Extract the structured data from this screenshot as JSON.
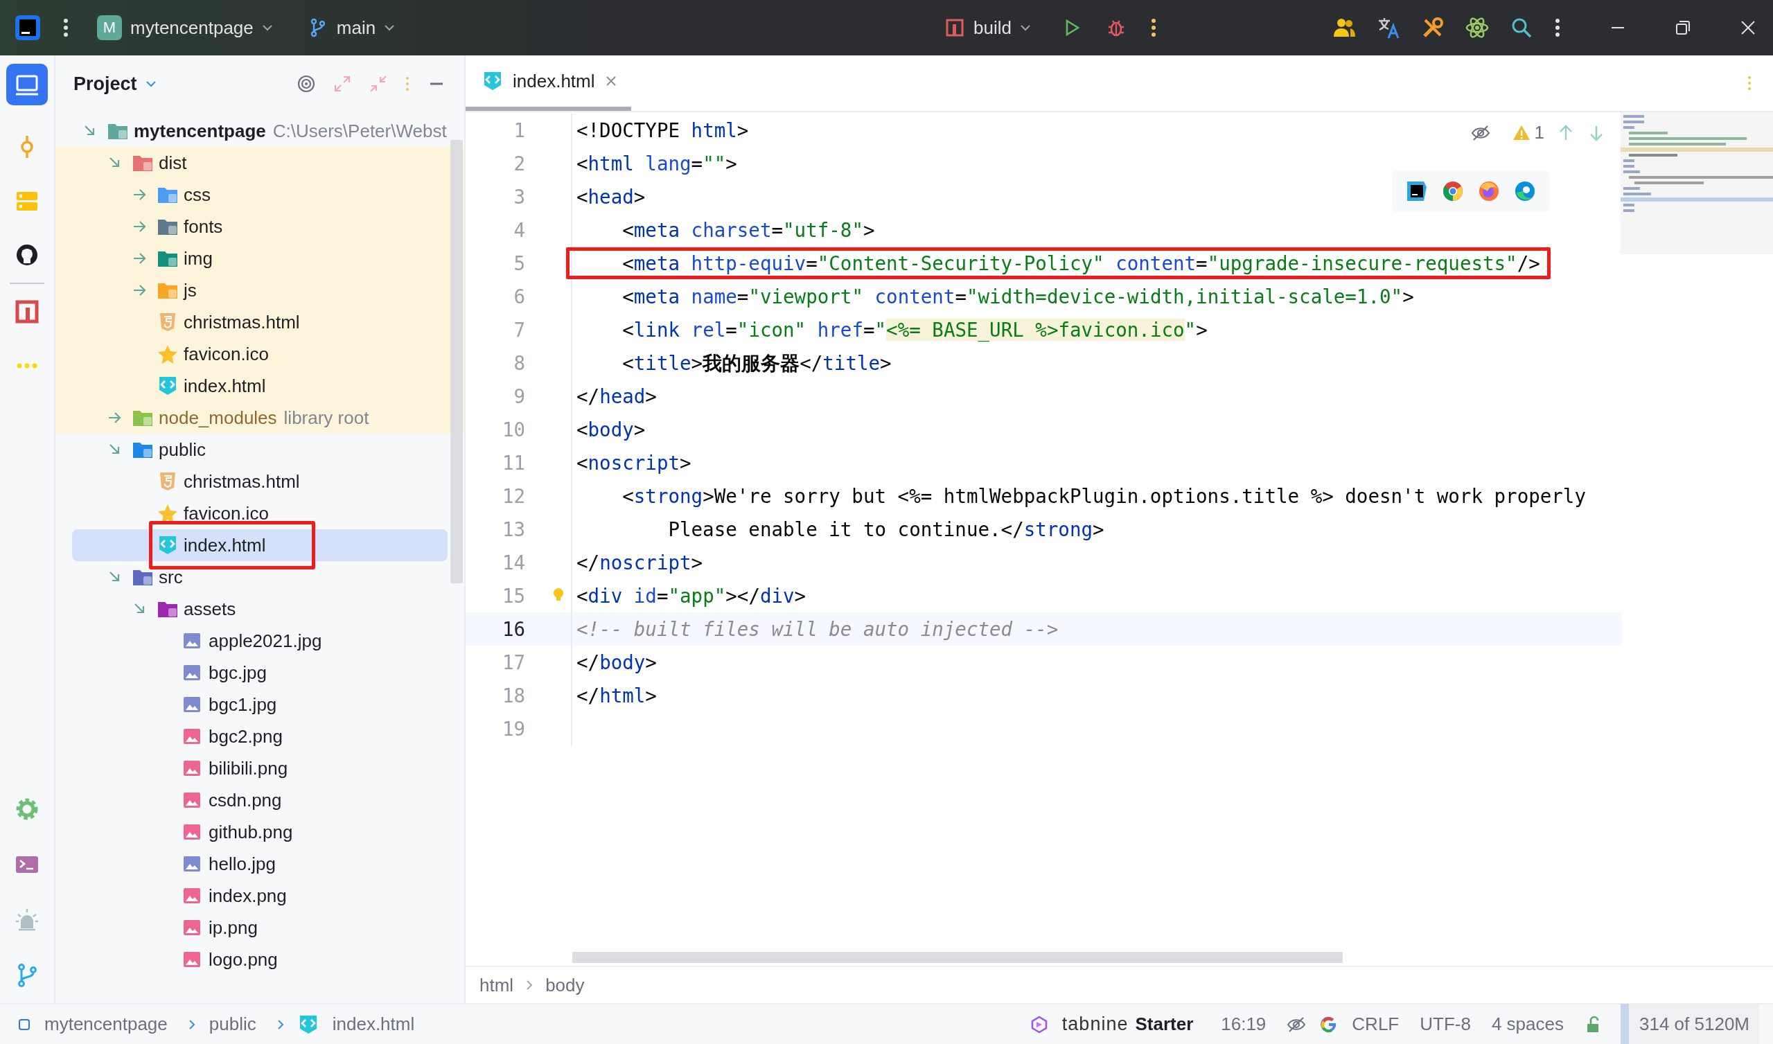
{
  "title_bar": {
    "project_badge": "M",
    "project": "mytencentpage",
    "branch": "main",
    "run_config": "build"
  },
  "project_panel": {
    "title": "Project"
  },
  "tree": [
    {
      "name": "mytencentpage",
      "kind": "module",
      "path": "C:\\Users\\Peter\\Webst",
      "expanded": true,
      "selected": false,
      "annotated": false,
      "children": [
        {
          "name": "dist",
          "kind": "dist",
          "expanded": true,
          "excluded": true,
          "selected": false,
          "annotated": false,
          "children": [
            {
              "name": "css",
              "kind": "css",
              "expanded": false,
              "selected": false,
              "annotated": false
            },
            {
              "name": "fonts",
              "kind": "fonts",
              "expanded": false,
              "selected": false,
              "annotated": false
            },
            {
              "name": "img",
              "kind": "img",
              "expanded": false,
              "selected": false,
              "annotated": false
            },
            {
              "name": "js",
              "kind": "js",
              "expanded": false,
              "selected": false,
              "annotated": false
            },
            {
              "name": "christmas.html",
              "kind": "html5",
              "selected": false,
              "annotated": false
            },
            {
              "name": "favicon.ico",
              "kind": "favicon",
              "selected": false,
              "annotated": false
            },
            {
              "name": "index.html",
              "kind": "webpage",
              "selected": false,
              "annotated": false
            }
          ]
        },
        {
          "name": "node_modules",
          "kind": "node",
          "suffix": "library root",
          "expanded": false,
          "excluded": true,
          "selected": false,
          "annotated": false
        },
        {
          "name": "public",
          "kind": "public",
          "expanded": true,
          "excluded": false,
          "selected": false,
          "annotated": false,
          "children": [
            {
              "name": "christmas.html",
              "kind": "html5",
              "selected": false,
              "annotated": false
            },
            {
              "name": "favicon.ico",
              "kind": "favicon",
              "selected": false,
              "annotated": false
            },
            {
              "name": "index.html",
              "kind": "webpage",
              "selected": true,
              "annotated": true
            }
          ]
        },
        {
          "name": "src",
          "kind": "src",
          "expanded": true,
          "excluded": false,
          "selected": false,
          "annotated": false,
          "children": [
            {
              "name": "assets",
              "kind": "assets",
              "expanded": true,
              "selected": false,
              "annotated": false,
              "children": [
                {
                  "name": "apple2021.jpg",
                  "kind": "jpg",
                  "selected": false,
                  "annotated": false
                },
                {
                  "name": "bgc.jpg",
                  "kind": "jpg",
                  "selected": false,
                  "annotated": false
                },
                {
                  "name": "bgc1.jpg",
                  "kind": "jpg",
                  "selected": false,
                  "annotated": false
                },
                {
                  "name": "bgc2.png",
                  "kind": "png",
                  "selected": false,
                  "annotated": false
                },
                {
                  "name": "bilibili.png",
                  "kind": "png",
                  "selected": false,
                  "annotated": false
                },
                {
                  "name": "csdn.png",
                  "kind": "png",
                  "selected": false,
                  "annotated": false
                },
                {
                  "name": "github.png",
                  "kind": "png",
                  "selected": false,
                  "annotated": false
                },
                {
                  "name": "hello.jpg",
                  "kind": "jpg",
                  "selected": false,
                  "annotated": false
                },
                {
                  "name": "index.png",
                  "kind": "png",
                  "selected": false,
                  "annotated": false
                },
                {
                  "name": "ip.png",
                  "kind": "png",
                  "selected": false,
                  "annotated": false
                },
                {
                  "name": "logo.png",
                  "kind": "png",
                  "selected": false,
                  "annotated": false
                }
              ]
            }
          ]
        }
      ]
    }
  ],
  "tabs": [
    {
      "label": "index.html",
      "selected": true
    }
  ],
  "inspection": {
    "warnings": "1"
  },
  "code": [
    {
      "no": "1",
      "current": false,
      "tokens": [
        {
          "kind": "p",
          "text": "<!DOCTYPE "
        },
        {
          "kind": "tag",
          "text": "html"
        },
        {
          "kind": "p",
          "text": ">"
        }
      ]
    },
    {
      "no": "2",
      "current": false,
      "tokens": [
        {
          "kind": "p",
          "text": "<"
        },
        {
          "kind": "tag",
          "text": "html"
        },
        {
          "kind": "attr",
          "text": " lang"
        },
        {
          "kind": "p",
          "text": "="
        },
        {
          "kind": "str",
          "text": "\"\""
        },
        {
          "kind": "p",
          "text": ">"
        }
      ]
    },
    {
      "no": "3",
      "current": false,
      "tokens": [
        {
          "kind": "p",
          "text": "<"
        },
        {
          "kind": "tag",
          "text": "head"
        },
        {
          "kind": "p",
          "text": ">"
        }
      ]
    },
    {
      "no": "4",
      "current": false,
      "tokens": [
        {
          "kind": "p",
          "text": "    <"
        },
        {
          "kind": "tag",
          "text": "meta"
        },
        {
          "kind": "attr",
          "text": " charset"
        },
        {
          "kind": "p",
          "text": "="
        },
        {
          "kind": "str",
          "text": "\"utf-8\""
        },
        {
          "kind": "p",
          "text": ">"
        }
      ]
    },
    {
      "no": "5",
      "current": false,
      "annotated": true,
      "tokens": [
        {
          "kind": "p",
          "text": "    <"
        },
        {
          "kind": "tag",
          "text": "meta"
        },
        {
          "kind": "attr",
          "text": " http-equiv"
        },
        {
          "kind": "p",
          "text": "="
        },
        {
          "kind": "str",
          "text": "\"Content-Security-Policy\""
        },
        {
          "kind": "attr",
          "text": " content"
        },
        {
          "kind": "p",
          "text": "="
        },
        {
          "kind": "str",
          "text": "\"upgrade-insecure-requests\""
        },
        {
          "kind": "p",
          "text": "/>"
        }
      ]
    },
    {
      "no": "6",
      "current": false,
      "tokens": [
        {
          "kind": "p",
          "text": "    <"
        },
        {
          "kind": "tag",
          "text": "meta"
        },
        {
          "kind": "attr",
          "text": " name"
        },
        {
          "kind": "p",
          "text": "="
        },
        {
          "kind": "str",
          "text": "\"viewport\""
        },
        {
          "kind": "attr",
          "text": " content"
        },
        {
          "kind": "p",
          "text": "="
        },
        {
          "kind": "str",
          "text": "\"width=device-width,initial-scale=1.0\""
        },
        {
          "kind": "p",
          "text": ">"
        }
      ]
    },
    {
      "no": "7",
      "current": false,
      "tokens": [
        {
          "kind": "p",
          "text": "    <"
        },
        {
          "kind": "tag",
          "text": "link"
        },
        {
          "kind": "attr",
          "text": " rel"
        },
        {
          "kind": "p",
          "text": "="
        },
        {
          "kind": "str",
          "text": "\"icon\""
        },
        {
          "kind": "attr",
          "text": " href"
        },
        {
          "kind": "p",
          "text": "="
        },
        {
          "kind": "str",
          "text": "\""
        },
        {
          "kind": "tpl",
          "text": "<%= BASE_URL %>favicon.ico"
        },
        {
          "kind": "str",
          "text": "\""
        },
        {
          "kind": "p",
          "text": ">"
        }
      ]
    },
    {
      "no": "8",
      "current": false,
      "tokens": [
        {
          "kind": "p",
          "text": "    <"
        },
        {
          "kind": "tag",
          "text": "title"
        },
        {
          "kind": "p",
          "text": ">"
        },
        {
          "kind": "bold",
          "text": "我的服务器"
        },
        {
          "kind": "p",
          "text": "</"
        },
        {
          "kind": "tag",
          "text": "title"
        },
        {
          "kind": "p",
          "text": ">"
        }
      ]
    },
    {
      "no": "9",
      "current": false,
      "tokens": [
        {
          "kind": "p",
          "text": "</"
        },
        {
          "kind": "tag",
          "text": "head"
        },
        {
          "kind": "p",
          "text": ">"
        }
      ]
    },
    {
      "no": "10",
      "current": false,
      "tokens": [
        {
          "kind": "p",
          "text": "<"
        },
        {
          "kind": "tag",
          "text": "body"
        },
        {
          "kind": "p",
          "text": ">"
        }
      ]
    },
    {
      "no": "11",
      "current": false,
      "tokens": [
        {
          "kind": "p",
          "text": "<"
        },
        {
          "kind": "tag",
          "text": "noscript"
        },
        {
          "kind": "p",
          "text": ">"
        }
      ]
    },
    {
      "no": "12",
      "current": false,
      "tokens": [
        {
          "kind": "p",
          "text": "    <"
        },
        {
          "kind": "tag",
          "text": "strong"
        },
        {
          "kind": "p",
          "text": ">We're sorry but <%= htmlWebpackPlugin.options.title %> doesn't work properly"
        }
      ]
    },
    {
      "no": "13",
      "current": false,
      "tokens": [
        {
          "kind": "p",
          "text": "        Please enable it to continue.</"
        },
        {
          "kind": "tag",
          "text": "strong"
        },
        {
          "kind": "p",
          "text": ">"
        }
      ]
    },
    {
      "no": "14",
      "current": false,
      "tokens": [
        {
          "kind": "p",
          "text": "</"
        },
        {
          "kind": "tag",
          "text": "noscript"
        },
        {
          "kind": "p",
          "text": ">"
        }
      ]
    },
    {
      "no": "15",
      "current": false,
      "bulb": true,
      "tokens": [
        {
          "kind": "p",
          "text": "<"
        },
        {
          "kind": "tag",
          "text": "div"
        },
        {
          "kind": "attr",
          "text": " id"
        },
        {
          "kind": "p",
          "text": "="
        },
        {
          "kind": "str",
          "text": "\"app\""
        },
        {
          "kind": "p",
          "text": "></"
        },
        {
          "kind": "tag",
          "text": "div"
        },
        {
          "kind": "p",
          "text": ">"
        }
      ]
    },
    {
      "no": "16",
      "current": true,
      "tokens": [
        {
          "kind": "cmt",
          "text": "<!-- built files will be auto injected -->"
        }
      ]
    },
    {
      "no": "17",
      "current": false,
      "tokens": [
        {
          "kind": "p",
          "text": "</"
        },
        {
          "kind": "tag",
          "text": "body"
        },
        {
          "kind": "p",
          "text": ">"
        }
      ]
    },
    {
      "no": "18",
      "current": false,
      "tokens": [
        {
          "kind": "p",
          "text": "</"
        },
        {
          "kind": "tag",
          "text": "html"
        },
        {
          "kind": "p",
          "text": ">"
        }
      ]
    },
    {
      "no": "19",
      "current": false
    }
  ],
  "editor_breadcrumbs": [
    "html",
    "body"
  ],
  "status_bar": {
    "path": [
      {
        "kind": "project",
        "label": "mytencentpage"
      },
      {
        "kind": "folder",
        "label": "public"
      },
      {
        "kind": "webpage",
        "label": "index.html"
      }
    ],
    "tabnine": {
      "brand": "tabnine",
      "plan": "Starter"
    },
    "position": "16:19",
    "line_separator": "CRLF",
    "encoding": "UTF-8",
    "indent": "4 spaces",
    "memory": {
      "text": "314 of 5120M",
      "level": 0.06
    }
  }
}
